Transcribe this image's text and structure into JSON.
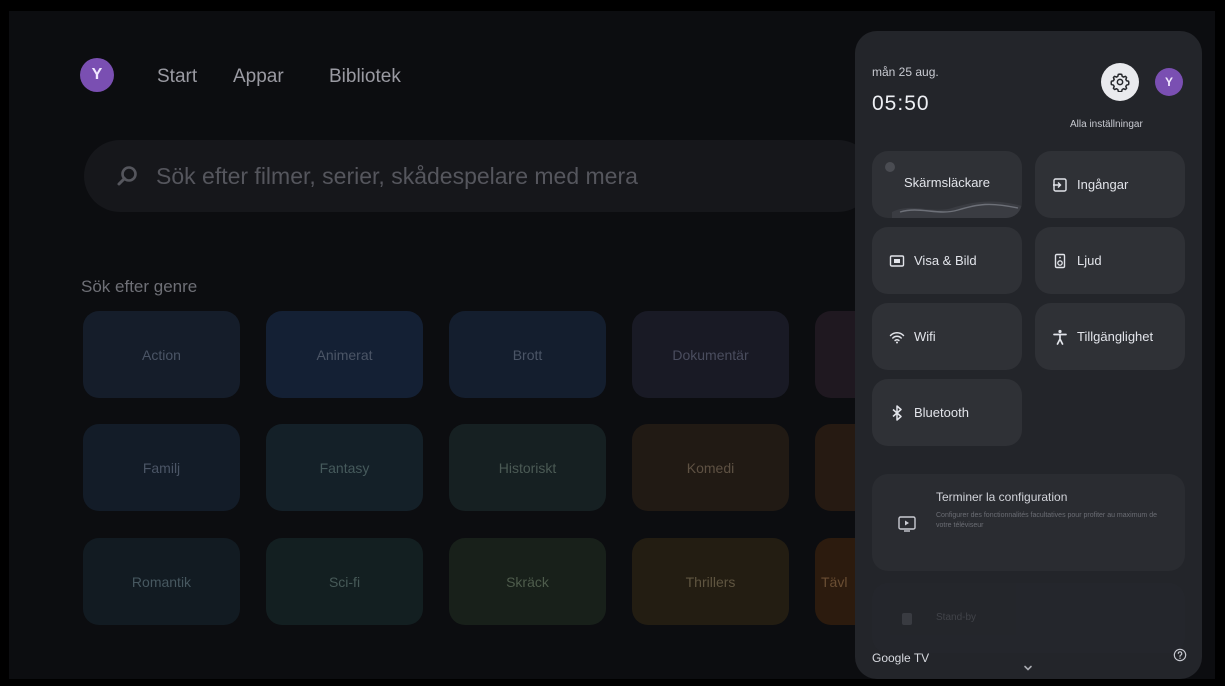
{
  "nav": {
    "avatar_letter": "Y",
    "items": [
      "Start",
      "Appar",
      "Bibliotek"
    ]
  },
  "search": {
    "placeholder": "Sök efter filmer, serier, skådespelare med mera",
    "icon": "search-icon"
  },
  "genres": {
    "heading": "Sök efter genre",
    "rows": [
      [
        "Action",
        "Animerat",
        "Brott",
        "Dokumentär",
        ""
      ],
      [
        "Familj",
        "Fantasy",
        "Historiskt",
        "Komedi",
        ""
      ],
      [
        "Romantik",
        "Sci-fi",
        "Skräck",
        "Thrillers",
        "Tävl"
      ]
    ]
  },
  "quick_settings": {
    "date": "mån 25 aug.",
    "time": "05:50",
    "avatar_letter": "Y",
    "settings_label": "Alla inställningar",
    "tiles": {
      "screensaver": "Skärmsläckare",
      "inputs": "Ingångar",
      "display": "Visa & Bild",
      "sound": "Ljud",
      "wifi": "Wifi",
      "accessibility": "Tillgänglighet",
      "bluetooth": "Bluetooth"
    },
    "config_card": {
      "title": "Terminer la configuration",
      "description": "Configurer des fonctionnalités facultatives pour profiter au maximum de votre téléviseur"
    },
    "faded_item": "Stand-by",
    "footer_brand": "Google TV"
  }
}
